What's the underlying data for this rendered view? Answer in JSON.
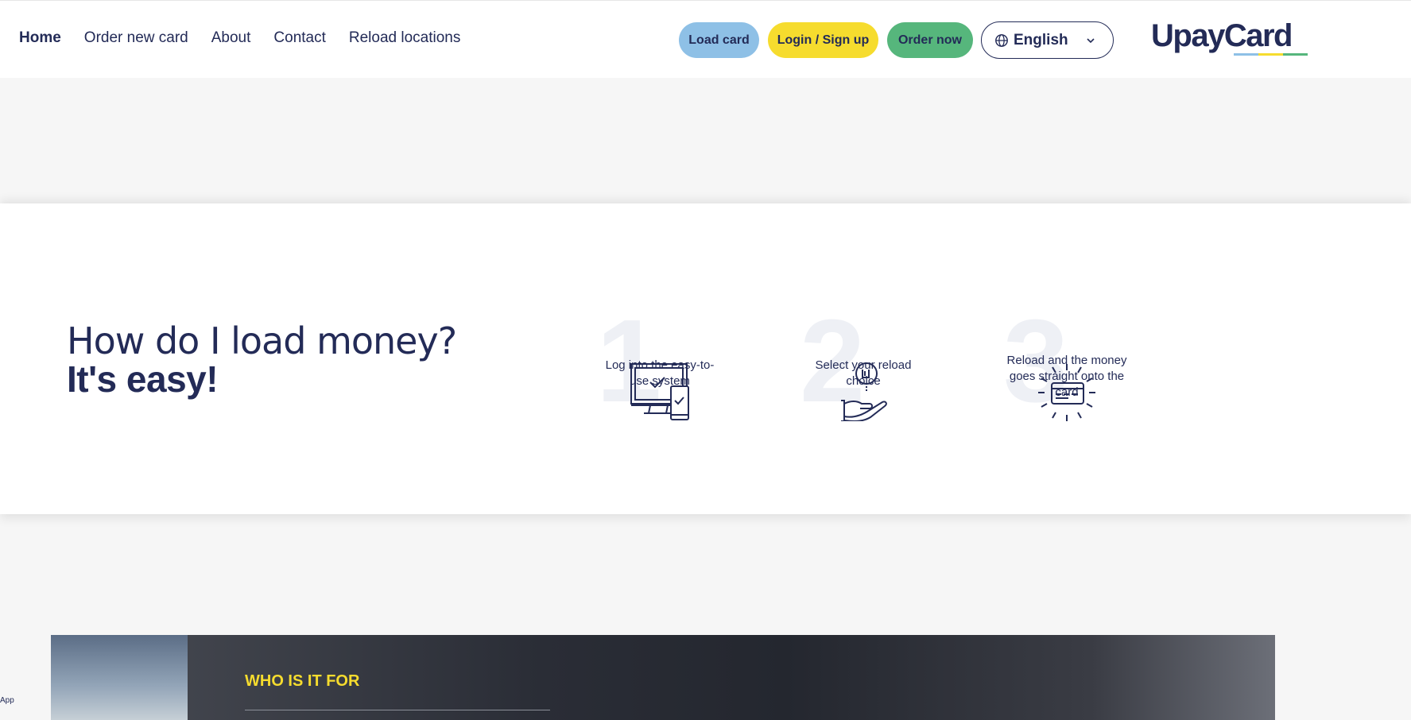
{
  "nav": {
    "items": [
      {
        "label": "Home",
        "active": true
      },
      {
        "label": "Order new card"
      },
      {
        "label": "About"
      },
      {
        "label": "Contact"
      },
      {
        "label": "Reload locations"
      }
    ]
  },
  "actions": {
    "load_card": "Load card",
    "login": "Login / Sign up",
    "order_now": "Order now"
  },
  "language": {
    "selected": "English",
    "icon": "globe-icon"
  },
  "logo": {
    "text": "UpayCard",
    "bar_colors": [
      "#8ec0e6",
      "#f6dc2e",
      "#56b67c"
    ]
  },
  "how": {
    "title_line1": "How do I load money?",
    "title_line2": "It's easy!",
    "steps": [
      {
        "number": "1",
        "text": "Log into the easy-to-use system",
        "icon": "computer-phone-icon"
      },
      {
        "number": "2",
        "text": "Select your reload choice",
        "icon": "hand-coin-icon"
      },
      {
        "number": "3",
        "text": "Reload and the money goes straight onto the card",
        "icon": "card-shine-icon"
      }
    ]
  },
  "banner": {
    "label": "WHO IS IT FOR"
  },
  "footer_tag": "App",
  "colors": {
    "navy": "#232b57",
    "load_blue": "#8ec0e6",
    "login_yellow": "#f6dc2e",
    "order_green": "#56b67c"
  }
}
